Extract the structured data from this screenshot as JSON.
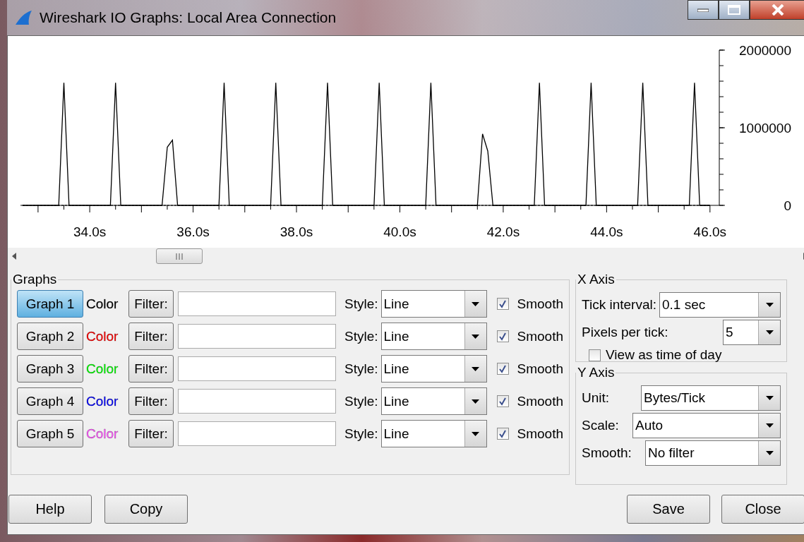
{
  "window": {
    "title": "Wireshark IO Graphs: Local Area Connection"
  },
  "chart": {
    "chart_data": {
      "type": "line",
      "x": [
        32.7,
        33.4,
        33.5,
        33.6,
        34.4,
        34.5,
        34.6,
        35.4,
        35.5,
        35.6,
        35.7,
        36.5,
        36.6,
        36.7,
        37.5,
        37.6,
        37.7,
        38.5,
        38.6,
        38.7,
        39.5,
        39.6,
        39.7,
        40.5,
        40.6,
        40.7,
        41.5,
        41.6,
        41.7,
        41.8,
        42.6,
        42.7,
        42.8,
        43.6,
        43.7,
        43.8,
        44.6,
        44.7,
        44.8,
        45.6,
        45.7,
        45.8,
        46.0
      ],
      "series": [
        {
          "color": "#000000",
          "values": [
            0,
            0,
            1580000,
            0,
            0,
            1580000,
            0,
            0,
            750000,
            840000,
            0,
            0,
            1580000,
            0,
            0,
            1580000,
            0,
            0,
            1580000,
            0,
            0,
            1580000,
            0,
            0,
            1580000,
            0,
            0,
            920000,
            700000,
            0,
            0,
            1580000,
            0,
            0,
            1580000,
            0,
            0,
            1580000,
            0,
            0,
            1580000,
            0,
            0
          ]
        }
      ],
      "xlim": [
        32.66,
        46.18
      ],
      "ylim": [
        0,
        2000000
      ],
      "xticks": [
        {
          "value": 34,
          "label": "34.0s"
        },
        {
          "value": 36,
          "label": "36.0s"
        },
        {
          "value": 38,
          "label": "38.0s"
        },
        {
          "value": 40,
          "label": "40.0s"
        },
        {
          "value": 42,
          "label": "42.0s"
        },
        {
          "value": 44,
          "label": "44.0s"
        },
        {
          "value": 46,
          "label": "46.0s"
        }
      ],
      "yticks": [
        {
          "value": 0,
          "label": "0"
        },
        {
          "value": 1000000,
          "label": "1000000"
        },
        {
          "value": 2000000,
          "label": "2000000"
        }
      ]
    }
  },
  "graphs": {
    "title": "Graphs",
    "rows": [
      {
        "button": "Graph 1",
        "selected": true,
        "color_label": "Color",
        "color": "#000000",
        "filter_button": "Filter:",
        "style_label": "Style:",
        "style": "Line",
        "smooth": {
          "label": "Smooth",
          "checked": true
        }
      },
      {
        "button": "Graph 2",
        "selected": false,
        "color_label": "Color",
        "color": "#ff0000",
        "filter_button": "Filter:",
        "style_label": "Style:",
        "style": "Line",
        "smooth": {
          "label": "Smooth",
          "checked": true
        }
      },
      {
        "button": "Graph 3",
        "selected": false,
        "color_label": "Color",
        "color": "#00ff00",
        "filter_button": "Filter:",
        "style_label": "Style:",
        "style": "Line",
        "smooth": {
          "label": "Smooth",
          "checked": true
        }
      },
      {
        "button": "Graph 4",
        "selected": false,
        "color_label": "Color",
        "color": "#0000ff",
        "filter_button": "Filter:",
        "style_label": "Style:",
        "style": "Line",
        "smooth": {
          "label": "Smooth",
          "checked": true
        }
      },
      {
        "button": "Graph 5",
        "selected": false,
        "color_label": "Color",
        "color": "#ff55ff",
        "filter_button": "Filter:",
        "style_label": "Style:",
        "style": "Line",
        "smooth": {
          "label": "Smooth",
          "checked": true
        }
      }
    ]
  },
  "x_axis": {
    "title": "X Axis",
    "tick_interval": {
      "label": "Tick interval:",
      "value": "0.1 sec"
    },
    "pixels_per_tick": {
      "label": "Pixels per tick:",
      "value": "5"
    },
    "time_of_day": {
      "label": "View as time of day",
      "checked": false
    }
  },
  "y_axis": {
    "title": "Y Axis",
    "fields": [
      {
        "label": "Unit:",
        "value": "Bytes/Tick"
      },
      {
        "label": "Scale:",
        "value": "Auto"
      },
      {
        "label": "Smooth:",
        "value": "No filter"
      }
    ]
  },
  "left_buttons": [
    "Help",
    "Copy"
  ],
  "right_buttons": [
    "Save",
    "Close"
  ]
}
